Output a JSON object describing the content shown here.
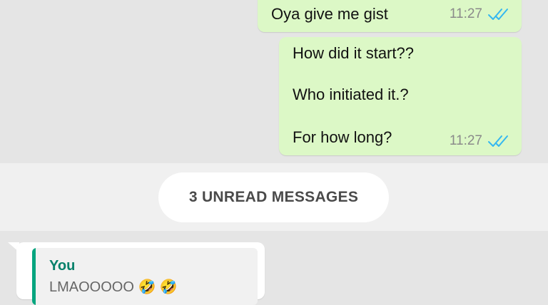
{
  "conversation": {
    "outgoing": [
      {
        "lines": [
          "Oya give me gist"
        ],
        "time": "11:27",
        "status": "read"
      },
      {
        "lines": [
          "How did it start??",
          "Who initiated it.?",
          "For how long?"
        ],
        "time": "11:27",
        "status": "read"
      }
    ],
    "unread_banner": "3 UNREAD MESSAGES",
    "incoming": {
      "quoted_author": "You",
      "quoted_text": "LMAOOOOO 🤣 🤣"
    }
  },
  "colors": {
    "background": "#e5e5e5",
    "outgoing_bubble": "#dcf8c6",
    "incoming_bubble": "#ffffff",
    "read_ticks": "#34b7f1",
    "quote_accent": "#06a57f"
  },
  "icons": {
    "read_status": "double-check-icon"
  }
}
